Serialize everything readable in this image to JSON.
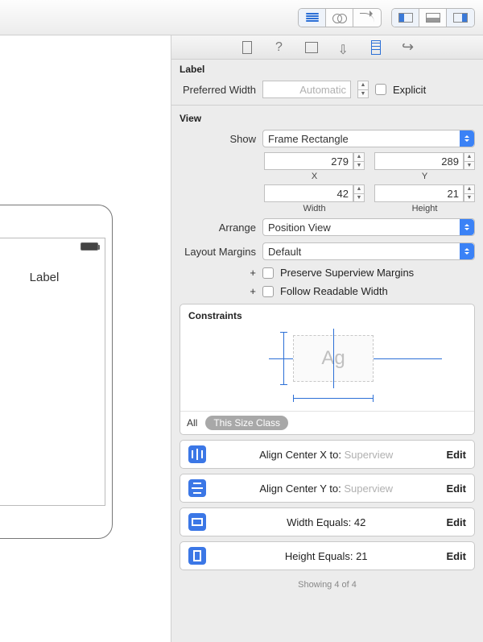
{
  "canvas": {
    "label_text": "Label"
  },
  "sections": {
    "label_title": "Label",
    "view_title": "View",
    "constraints_title": "Constraints"
  },
  "label_section": {
    "preferred_width_label": "Preferred Width",
    "preferred_width_placeholder": "Automatic",
    "explicit_label": "Explicit"
  },
  "view_section": {
    "show_label": "Show",
    "show_value": "Frame Rectangle",
    "x_value": "279",
    "x_label": "X",
    "y_value": "289",
    "y_label": "Y",
    "width_value": "42",
    "width_label": "Width",
    "height_value": "21",
    "height_label": "Height",
    "arrange_label": "Arrange",
    "arrange_value": "Position View",
    "layout_margins_label": "Layout Margins",
    "layout_margins_value": "Default",
    "preserve_label": "Preserve Superview Margins",
    "follow_label": "Follow Readable Width"
  },
  "constraints_section": {
    "diagram_text": "Ag",
    "tab_all": "All",
    "tab_size": "This Size Class",
    "items": [
      {
        "icon": "center-x",
        "text": "Align Center X to:",
        "target": "Superview",
        "edit": "Edit"
      },
      {
        "icon": "center-y",
        "text": "Align Center Y to:",
        "target": "Superview",
        "edit": "Edit"
      },
      {
        "icon": "width",
        "text": "Width Equals:",
        "target": "42",
        "edit": "Edit"
      },
      {
        "icon": "height",
        "text": "Height Equals:",
        "target": "21",
        "edit": "Edit"
      }
    ],
    "footer": "Showing 4 of 4"
  }
}
